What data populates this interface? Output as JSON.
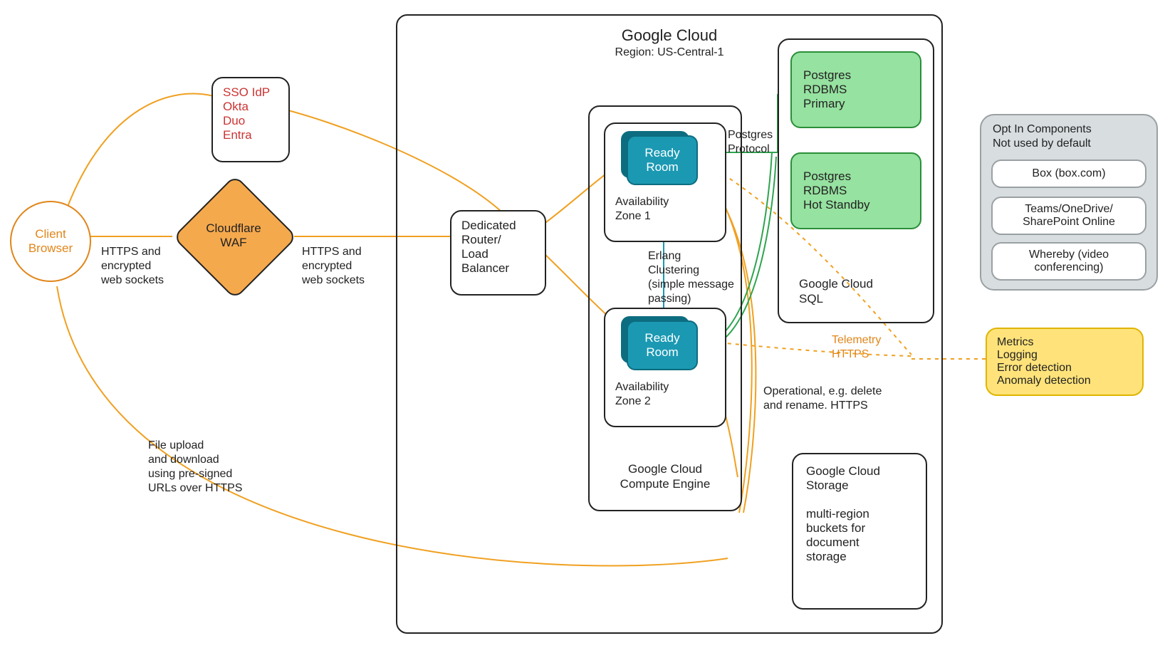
{
  "client": {
    "title": "Client\nBrowser"
  },
  "sso": {
    "lines": [
      "SSO IdP",
      "Okta",
      "Duo",
      "Entra"
    ]
  },
  "waf": {
    "title": "Cloudflare\nWAF"
  },
  "conn": {
    "https_ws_left": "HTTPS and\nencrypted\nweb sockets",
    "https_ws_right": "HTTPS and\nencrypted\nweb sockets",
    "file_upload": "File upload\nand download\nusing pre-signed\nURLs over HTTPS",
    "erlang": "Erlang\nClustering\n(simple message\npassing)",
    "pg_protocol": "Postgres\nProtocol",
    "operational": "Operational, e.g. delete\nand rename. HTTPS",
    "telemetry": "Telemetry\nHTTPS"
  },
  "gcp": {
    "title": "Google Cloud",
    "region": "Region: US-Central-1",
    "router": "Dedicated\nRouter/\nLoad\nBalancer",
    "compute": {
      "title": "Google Cloud\nCompute Engine",
      "az1": "Availability\nZone 1",
      "az2": "Availability\nZone 2",
      "app": "Ready\nRoom"
    },
    "sql": {
      "title": "Google Cloud\nSQL",
      "primary": "Postgres\nRDBMS\nPrimary",
      "standby": "Postgres\nRDBMS\nHot Standby"
    },
    "storage": "Google Cloud\nStorage\n\nmulti-region\nbuckets for\ndocument\nstorage"
  },
  "optin": {
    "title": "Opt In Components\nNot used by default",
    "items": [
      "Box (box.com)",
      "Teams/OneDrive/\nSharePoint Online",
      "Whereby (video\nconferencing)"
    ]
  },
  "telemetry_box": {
    "lines": [
      "Metrics",
      "Logging",
      "Error detection",
      "Anomaly detection"
    ]
  }
}
